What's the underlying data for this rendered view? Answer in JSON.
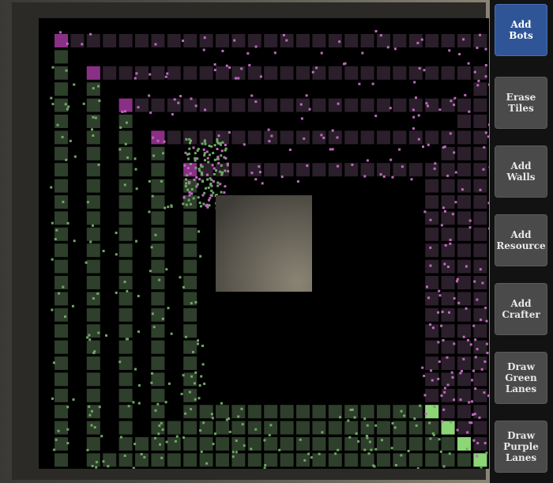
{
  "toolbar": {
    "buttons": [
      {
        "id": "add-bots",
        "label": "Add\nBots",
        "active": true
      },
      {
        "id": "erase-tiles",
        "label": "Erase\nTiles",
        "active": false
      },
      {
        "id": "add-walls",
        "label": "Add\nWalls",
        "active": false
      },
      {
        "id": "add-resource",
        "label": "Add\nResource",
        "active": false
      },
      {
        "id": "add-crafter",
        "label": "Add\nCrafter",
        "active": false
      },
      {
        "id": "draw-green-lanes",
        "label": "Draw\nGreen\nLanes",
        "active": false
      },
      {
        "id": "draw-purple-lanes",
        "label": "Draw\nPurple\nLanes",
        "active": false
      }
    ]
  },
  "colors": {
    "green_lane": "#2e3f2b",
    "purple_lane": "#2b1f2b",
    "green_bot": "#6fa866",
    "purple_bot": "#c06abf",
    "green_endpoint": "#8cd676",
    "purple_endpoint": "#8a2f86",
    "center_block": "#6f6a5f"
  },
  "board": {
    "grid_size": 28,
    "rings": 5
  }
}
